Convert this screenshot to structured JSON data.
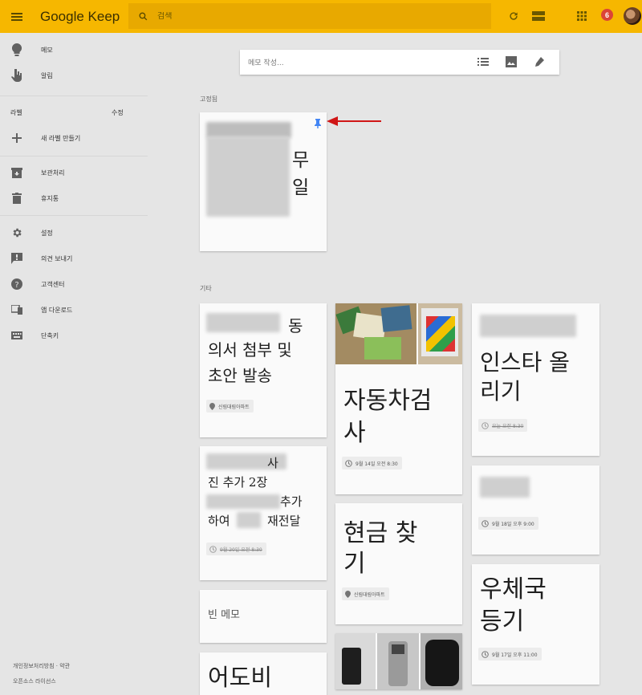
{
  "header": {
    "logo": "Google Keep",
    "search_placeholder": "검색",
    "notification_count": "6"
  },
  "sidebar": {
    "items": [
      {
        "label": "메모",
        "icon": "lightbulb-icon"
      },
      {
        "label": "알림",
        "icon": "reminder-hand-icon"
      }
    ],
    "labels_header": "라벨",
    "labels_edit": "수정",
    "new_label": "새 라벨 만들기",
    "items2": [
      {
        "label": "보관처리",
        "icon": "archive-icon"
      },
      {
        "label": "휴지통",
        "icon": "trash-icon"
      }
    ],
    "items3": [
      {
        "label": "설정",
        "icon": "settings-icon"
      },
      {
        "label": "의견 보내기",
        "icon": "feedback-icon"
      },
      {
        "label": "고객센터",
        "icon": "help-icon"
      },
      {
        "label": "앱 다운로드",
        "icon": "devices-icon"
      },
      {
        "label": "단축키",
        "icon": "keyboard-icon"
      }
    ],
    "footer": {
      "privacy": "개인정보처리방침 · 약관",
      "oss": "오픈소스 라이선스"
    }
  },
  "main": {
    "take_note_placeholder": "메모 작성...",
    "pinned_title": "고정됨",
    "others_title": "기타",
    "notes": {
      "pinned1": {
        "line1": "무",
        "line2": "일"
      },
      "n1": {
        "lines": [
          "동",
          "의서 첨부 및",
          "초안 발송"
        ],
        "chip": "신림대림아파트"
      },
      "n2": {
        "lines": [
          "사",
          "진 추가 2장",
          "추가",
          "하여",
          "재전달"
        ],
        "chip": "9월 20일 오전 8:30"
      },
      "n3": {
        "text": "빈 메모"
      },
      "n4": {
        "text": "어도비"
      },
      "n5": {
        "lines": [
          "자동차검",
          "사"
        ],
        "chip": "9월 14일 오전 8:30"
      },
      "n6": {
        "lines": [
          "현금 찾",
          "기"
        ],
        "chip": "신림대림아파트"
      },
      "n7": {
        "lines": [
          "인스타 올",
          "리기"
        ],
        "chip": "오늘 오전 8:30"
      },
      "n8": {
        "chip": "9월 18일 오후 9:00"
      },
      "n9": {
        "lines": [
          "우체국",
          "등기"
        ],
        "chip": "9월 17일 오후 11:00"
      }
    }
  },
  "colors": {
    "header": "#f6b700",
    "background": "#e5e5e5",
    "pin": "#4285f4",
    "annotation_arrow": "#d01616",
    "badge": "#db4437"
  }
}
